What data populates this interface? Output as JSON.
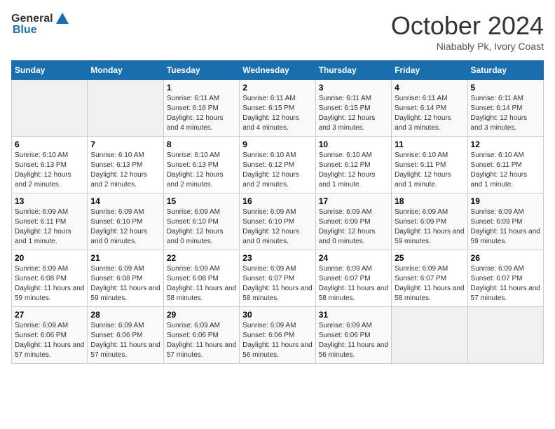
{
  "logo": {
    "general": "General",
    "blue": "Blue"
  },
  "header": {
    "month": "October 2024",
    "location": "Niabably Pk, Ivory Coast"
  },
  "weekdays": [
    "Sunday",
    "Monday",
    "Tuesday",
    "Wednesday",
    "Thursday",
    "Friday",
    "Saturday"
  ],
  "weeks": [
    [
      {
        "day": "",
        "empty": true
      },
      {
        "day": "",
        "empty": true
      },
      {
        "day": "1",
        "sunrise": "6:11 AM",
        "sunset": "6:16 PM",
        "daylight": "12 hours and 4 minutes."
      },
      {
        "day": "2",
        "sunrise": "6:11 AM",
        "sunset": "6:15 PM",
        "daylight": "12 hours and 4 minutes."
      },
      {
        "day": "3",
        "sunrise": "6:11 AM",
        "sunset": "6:15 PM",
        "daylight": "12 hours and 3 minutes."
      },
      {
        "day": "4",
        "sunrise": "6:11 AM",
        "sunset": "6:14 PM",
        "daylight": "12 hours and 3 minutes."
      },
      {
        "day": "5",
        "sunrise": "6:11 AM",
        "sunset": "6:14 PM",
        "daylight": "12 hours and 3 minutes."
      }
    ],
    [
      {
        "day": "6",
        "sunrise": "6:10 AM",
        "sunset": "6:13 PM",
        "daylight": "12 hours and 2 minutes."
      },
      {
        "day": "7",
        "sunrise": "6:10 AM",
        "sunset": "6:13 PM",
        "daylight": "12 hours and 2 minutes."
      },
      {
        "day": "8",
        "sunrise": "6:10 AM",
        "sunset": "6:13 PM",
        "daylight": "12 hours and 2 minutes."
      },
      {
        "day": "9",
        "sunrise": "6:10 AM",
        "sunset": "6:12 PM",
        "daylight": "12 hours and 2 minutes."
      },
      {
        "day": "10",
        "sunrise": "6:10 AM",
        "sunset": "6:12 PM",
        "daylight": "12 hours and 1 minute."
      },
      {
        "day": "11",
        "sunrise": "6:10 AM",
        "sunset": "6:11 PM",
        "daylight": "12 hours and 1 minute."
      },
      {
        "day": "12",
        "sunrise": "6:10 AM",
        "sunset": "6:11 PM",
        "daylight": "12 hours and 1 minute."
      }
    ],
    [
      {
        "day": "13",
        "sunrise": "6:09 AM",
        "sunset": "6:11 PM",
        "daylight": "12 hours and 1 minute."
      },
      {
        "day": "14",
        "sunrise": "6:09 AM",
        "sunset": "6:10 PM",
        "daylight": "12 hours and 0 minutes."
      },
      {
        "day": "15",
        "sunrise": "6:09 AM",
        "sunset": "6:10 PM",
        "daylight": "12 hours and 0 minutes."
      },
      {
        "day": "16",
        "sunrise": "6:09 AM",
        "sunset": "6:10 PM",
        "daylight": "12 hours and 0 minutes."
      },
      {
        "day": "17",
        "sunrise": "6:09 AM",
        "sunset": "6:09 PM",
        "daylight": "12 hours and 0 minutes."
      },
      {
        "day": "18",
        "sunrise": "6:09 AM",
        "sunset": "6:09 PM",
        "daylight": "11 hours and 59 minutes."
      },
      {
        "day": "19",
        "sunrise": "6:09 AM",
        "sunset": "6:09 PM",
        "daylight": "11 hours and 59 minutes."
      }
    ],
    [
      {
        "day": "20",
        "sunrise": "6:09 AM",
        "sunset": "6:08 PM",
        "daylight": "11 hours and 59 minutes."
      },
      {
        "day": "21",
        "sunrise": "6:09 AM",
        "sunset": "6:08 PM",
        "daylight": "11 hours and 59 minutes."
      },
      {
        "day": "22",
        "sunrise": "6:09 AM",
        "sunset": "6:08 PM",
        "daylight": "11 hours and 58 minutes."
      },
      {
        "day": "23",
        "sunrise": "6:09 AM",
        "sunset": "6:07 PM",
        "daylight": "11 hours and 58 minutes."
      },
      {
        "day": "24",
        "sunrise": "6:09 AM",
        "sunset": "6:07 PM",
        "daylight": "11 hours and 58 minutes."
      },
      {
        "day": "25",
        "sunrise": "6:09 AM",
        "sunset": "6:07 PM",
        "daylight": "11 hours and 58 minutes."
      },
      {
        "day": "26",
        "sunrise": "6:09 AM",
        "sunset": "6:07 PM",
        "daylight": "11 hours and 57 minutes."
      }
    ],
    [
      {
        "day": "27",
        "sunrise": "6:09 AM",
        "sunset": "6:06 PM",
        "daylight": "11 hours and 57 minutes."
      },
      {
        "day": "28",
        "sunrise": "6:09 AM",
        "sunset": "6:06 PM",
        "daylight": "11 hours and 57 minutes."
      },
      {
        "day": "29",
        "sunrise": "6:09 AM",
        "sunset": "6:06 PM",
        "daylight": "11 hours and 57 minutes."
      },
      {
        "day": "30",
        "sunrise": "6:09 AM",
        "sunset": "6:06 PM",
        "daylight": "11 hours and 56 minutes."
      },
      {
        "day": "31",
        "sunrise": "6:09 AM",
        "sunset": "6:06 PM",
        "daylight": "11 hours and 56 minutes."
      },
      {
        "day": "",
        "empty": true
      },
      {
        "day": "",
        "empty": true
      }
    ]
  ]
}
